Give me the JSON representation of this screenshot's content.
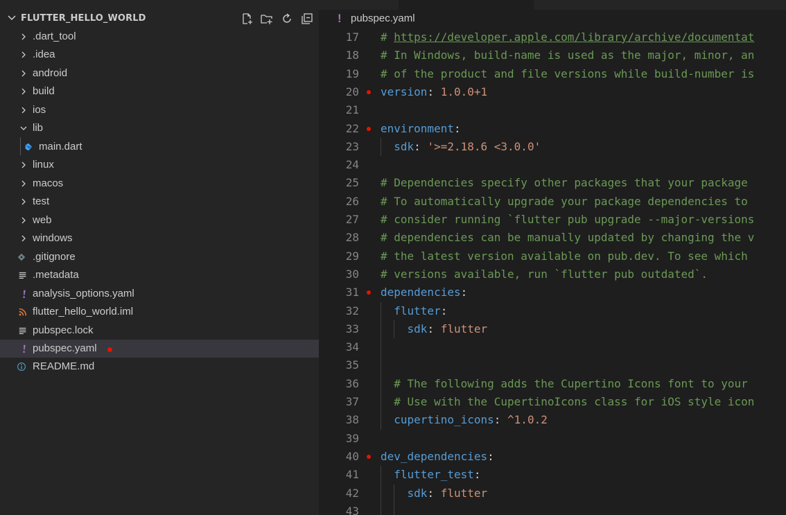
{
  "explorer": {
    "title": "FLUTTER_HELLO_WORLD",
    "toolbar_icons": [
      "new-file-icon",
      "new-folder-icon",
      "refresh-icon",
      "collapse-all-icon"
    ],
    "items": [
      {
        "label": ".dart_tool",
        "type": "folder",
        "state": "collapsed"
      },
      {
        "label": ".idea",
        "type": "folder",
        "state": "collapsed"
      },
      {
        "label": "android",
        "type": "folder",
        "state": "collapsed"
      },
      {
        "label": "build",
        "type": "folder",
        "state": "collapsed"
      },
      {
        "label": "ios",
        "type": "folder",
        "state": "collapsed"
      },
      {
        "label": "lib",
        "type": "folder",
        "state": "expanded"
      },
      {
        "label": "main.dart",
        "type": "file",
        "icon": "dart-icon"
      },
      {
        "label": "linux",
        "type": "folder",
        "state": "collapsed"
      },
      {
        "label": "macos",
        "type": "folder",
        "state": "collapsed"
      },
      {
        "label": "test",
        "type": "folder",
        "state": "collapsed"
      },
      {
        "label": "web",
        "type": "folder",
        "state": "collapsed"
      },
      {
        "label": "windows",
        "type": "folder",
        "state": "collapsed"
      },
      {
        "label": ".gitignore",
        "type": "file",
        "icon": "git-icon"
      },
      {
        "label": ".metadata",
        "type": "file",
        "icon": "text-lines-icon"
      },
      {
        "label": "analysis_options.yaml",
        "type": "file",
        "icon": "yaml-icon"
      },
      {
        "label": "flutter_hello_world.iml",
        "type": "file",
        "icon": "rss-icon"
      },
      {
        "label": "pubspec.lock",
        "type": "file",
        "icon": "text-lines-icon"
      },
      {
        "label": "pubspec.yaml",
        "type": "file",
        "icon": "yaml-icon",
        "selected": true,
        "modified": true
      },
      {
        "label": "README.md",
        "type": "file",
        "icon": "info-icon"
      }
    ]
  },
  "editor": {
    "breadcrumb": "pubspec.yaml",
    "lines": [
      {
        "n": "17",
        "text": "# https://developer.apple.com/library/archive/documentat"
      },
      {
        "n": "18",
        "text": "# In Windows, build-name is used as the major, minor, an"
      },
      {
        "n": "19",
        "text": "# of the product and file versions while build-number is"
      },
      {
        "n": "20",
        "key": "version",
        "value": " 1.0.0+1",
        "modified": true
      },
      {
        "n": "21",
        "text": ""
      },
      {
        "n": "22",
        "key": "environment",
        "value": "",
        "modified": true
      },
      {
        "n": "23",
        "indent": "  ",
        "key": "sdk",
        "value": " '>=2.18.6 <3.0.0'"
      },
      {
        "n": "24",
        "text": ""
      },
      {
        "n": "25",
        "text": "# Dependencies specify other packages that your package"
      },
      {
        "n": "26",
        "text": "# To automatically upgrade your package dependencies to"
      },
      {
        "n": "27",
        "text": "# consider running `flutter pub upgrade --major-versions"
      },
      {
        "n": "28",
        "text": "# dependencies can be manually updated by changing the v"
      },
      {
        "n": "29",
        "text": "# the latest version available on pub.dev. To see which"
      },
      {
        "n": "30",
        "text": "# versions available, run `flutter pub outdated`."
      },
      {
        "n": "31",
        "key": "dependencies",
        "value": "",
        "modified": true
      },
      {
        "n": "32",
        "indent": "  ",
        "key": "flutter",
        "value": ""
      },
      {
        "n": "33",
        "indent": "    ",
        "key": "sdk",
        "value": " flutter"
      },
      {
        "n": "34",
        "text": ""
      },
      {
        "n": "35",
        "text": ""
      },
      {
        "n": "36",
        "text": "  # The following adds the Cupertino Icons font to your"
      },
      {
        "n": "37",
        "text": "  # Use with the CupertinoIcons class for iOS style icon"
      },
      {
        "n": "38",
        "indent": "  ",
        "key": "cupertino_icons",
        "value": " ^1.0.2"
      },
      {
        "n": "39",
        "text": ""
      },
      {
        "n": "40",
        "key": "dev_dependencies",
        "value": "",
        "modified": true
      },
      {
        "n": "41",
        "indent": "  ",
        "key": "flutter_test",
        "value": ""
      },
      {
        "n": "42",
        "indent": "    ",
        "key": "sdk",
        "value": " flutter"
      },
      {
        "n": "43",
        "text": ""
      }
    ]
  },
  "colors": {
    "comment": "#6a9955",
    "key": "#569cd6",
    "string": "#ce9178",
    "modified_dot": "#e51400",
    "selection": "#37373d"
  }
}
